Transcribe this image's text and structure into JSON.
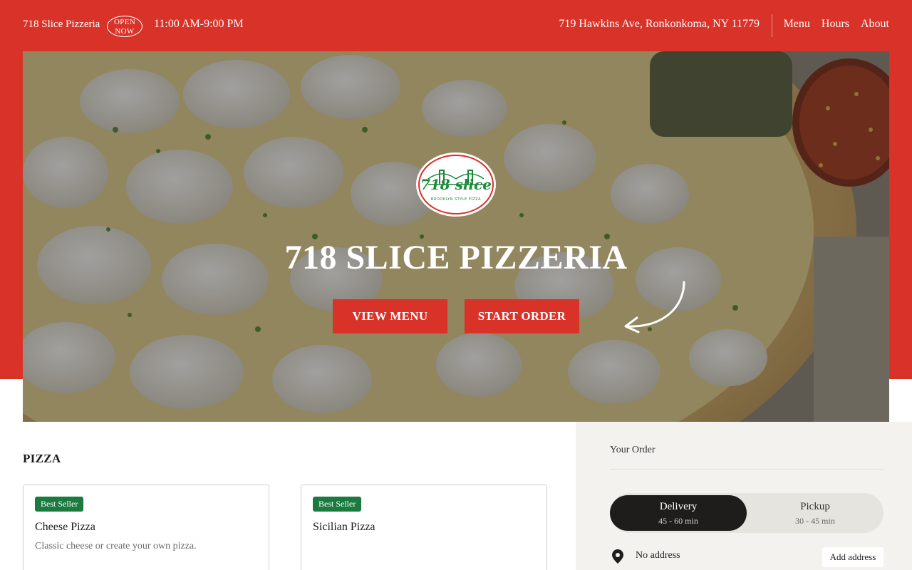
{
  "header": {
    "brand": "718 Slice Pizzeria",
    "open_badge": "OPEN NOW",
    "hours": "11:00 AM-9:00 PM",
    "address": "719 Hawkins Ave, Ronkonkoma, NY 11779",
    "nav": [
      "Menu",
      "Hours",
      "About"
    ]
  },
  "hero": {
    "logo_text": "718 slice",
    "logo_sub": "BROOKLYN STYLE PIZZA",
    "title": "718 SLICE PIZZERIA",
    "view_menu_label": "VIEW MENU",
    "start_order_label": "START ORDER"
  },
  "menu": {
    "section_title": "PIZZA",
    "items": [
      {
        "badge": "Best Seller",
        "name": "Cheese Pizza",
        "description": "Classic cheese or create your own pizza."
      },
      {
        "badge": "Best Seller",
        "name": "Sicilian Pizza",
        "description": ""
      }
    ]
  },
  "order": {
    "title": "Your Order",
    "delivery": {
      "label": "Delivery",
      "time": "45 - 60 min"
    },
    "pickup": {
      "label": "Pickup",
      "time": "30 - 45 min"
    },
    "address_text": "No address",
    "add_address_label": "Add address"
  },
  "colors": {
    "brand_red": "#d93228",
    "badge_green": "#1b7a3d",
    "toggle_dark": "#1f1c1c",
    "panel_bg": "#f3f2ef"
  },
  "icons": {
    "arrow": "curved-arrow-icon",
    "location": "map-pin-icon",
    "logo": "bridge-logo"
  }
}
